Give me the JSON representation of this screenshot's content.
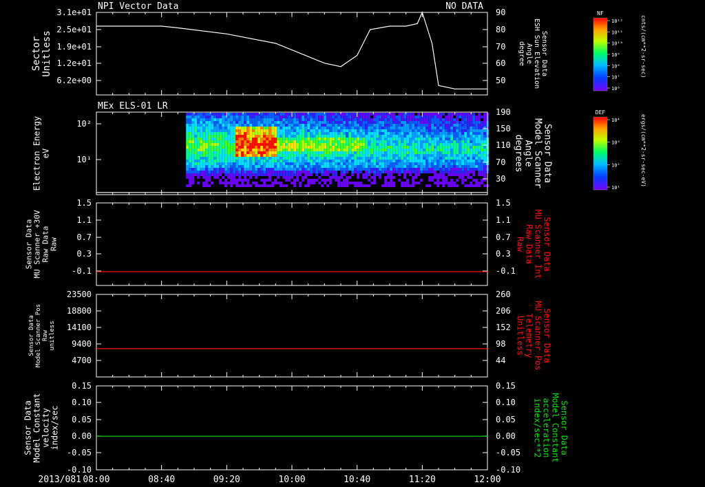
{
  "colors": {
    "background": "#000000",
    "axis": "#ffffff",
    "red_trace": "#ff1010",
    "green_trace": "#10e010"
  },
  "time_axis": {
    "date_label": "2013/081",
    "ticks": [
      "08:00",
      "08:40",
      "09:20",
      "10:00",
      "10:40",
      "11:20",
      "12:00"
    ]
  },
  "chart_data": [
    {
      "type": "line",
      "panel": "sector",
      "header_left": "NPI Vector Data",
      "header_right": "NO DATA",
      "ylabel_left": [
        "Sector",
        "Unitless"
      ],
      "yticks_left": [
        "3.1e+01",
        "2.5e+01",
        "1.9e+01",
        "1.2e+01",
        "6.2e+00"
      ],
      "ylabel_right": [
        "Sensor Data",
        "ESH Sun Elevation",
        "Angle",
        "degree"
      ],
      "yticks_right": [
        "90",
        "80",
        "70",
        "60",
        "50"
      ],
      "ylim_right": [
        42,
        90
      ],
      "series": [
        {
          "color": "#ffffff",
          "x": [
            "08:00",
            "08:40",
            "08:50",
            "09:20",
            "09:50",
            "10:20",
            "10:30",
            "10:40",
            "10:48",
            "11:00",
            "11:10",
            "11:17",
            "11:20",
            "11:26",
            "11:30",
            "11:40",
            "12:00"
          ],
          "y": [
            82,
            82,
            81,
            77.5,
            72,
            60.5,
            58.5,
            65,
            80,
            82,
            82,
            83.5,
            90,
            72,
            47.5,
            45.5,
            45.5
          ]
        }
      ]
    },
    {
      "type": "heatmap",
      "panel": "els",
      "header_left": "MEx ELS-01 LR",
      "ylabel_left": [
        "Electron Energy",
        "eV"
      ],
      "yticks_left": [
        "10²",
        "10¹"
      ],
      "ylabel_right": [
        "Sensor Data",
        "Model Scanner",
        "Angle",
        "degrees"
      ],
      "yticks_right": [
        "190",
        "150",
        "110",
        "70",
        "30"
      ],
      "ylim_right": [
        5,
        190
      ],
      "series": [
        {
          "color": "#ffffff",
          "x": [
            "08:00",
            "12:00"
          ],
          "y": [
            10,
            10
          ]
        }
      ],
      "data_start": "08:55",
      "data_end": "12:00",
      "colorbar": {
        "label": "DEF",
        "unit": "ergs/(cm**2-sr-sec-eV)",
        "ticks": [
          "10⁴",
          "10³",
          "10²",
          "10¹"
        ]
      }
    },
    {
      "type": "line",
      "panel": "mu_raw",
      "ylabel_left": [
        "Sensor Data",
        "MU Scanner +30V",
        "Raw Data",
        "Raw"
      ],
      "yticks_left": [
        "1.5",
        "1.1",
        "0.7",
        "0.3",
        "-0.1"
      ],
      "ylabel_right": [
        "Sensor Data",
        "MU Scanner Int",
        "Raw Data",
        "Raw"
      ],
      "yticks_right": [
        "1.5",
        "1.1",
        "0.7",
        "0.3",
        "-0.1"
      ],
      "ylim": [
        -0.3,
        1.5
      ],
      "series": [
        {
          "color": "#ff1010",
          "x": [
            "08:00",
            "12:00"
          ],
          "y": [
            0.0,
            0.0
          ]
        }
      ]
    },
    {
      "type": "line",
      "panel": "scanner_pos",
      "ylabel_left": [
        "Sensor Data",
        "Model Scanner Pos",
        "Raw",
        "unitless"
      ],
      "yticks_left": [
        "23500",
        "18800",
        "14100",
        "9400",
        "4700"
      ],
      "ylabel_right": [
        "Sensor Data",
        "MU Scanner Pos",
        "Telemetry",
        "Unitless"
      ],
      "yticks_right": [
        "260",
        "206",
        "152",
        "98",
        "44"
      ],
      "ylim": [
        0,
        23500
      ],
      "series": [
        {
          "color": "#ff1010",
          "x": [
            "08:00",
            "12:00"
          ],
          "y": [
            8050,
            8050
          ]
        }
      ]
    },
    {
      "type": "line",
      "panel": "model_constant",
      "ylabel_left": [
        "Sensor Data",
        "Model Constant",
        "velocity",
        "index/sec"
      ],
      "yticks_left": [
        "0.15",
        "0.10",
        "0.05",
        "0.00",
        "-0.05",
        "-0.10"
      ],
      "ylabel_right": [
        "Sensor Data",
        "Model Constant",
        "acceleration",
        "index/sec**2"
      ],
      "yticks_right": [
        "0.15",
        "0.10",
        "0.05",
        "0.00",
        "-0.05",
        "-0.10"
      ],
      "ylim": [
        -0.1,
        0.15
      ],
      "series": [
        {
          "color": "#10e010",
          "x": [
            "08:00",
            "12:00"
          ],
          "y": [
            0.0,
            0.0
          ]
        }
      ]
    }
  ],
  "colorbar_nf": {
    "label": "NF",
    "unit": "cnts/(cm**2-sr-sec)",
    "ticks": [
      "10¹²",
      "10¹¹",
      "10¹⁰",
      "10⁹",
      "10⁸",
      "10⁷",
      "10⁶"
    ]
  }
}
